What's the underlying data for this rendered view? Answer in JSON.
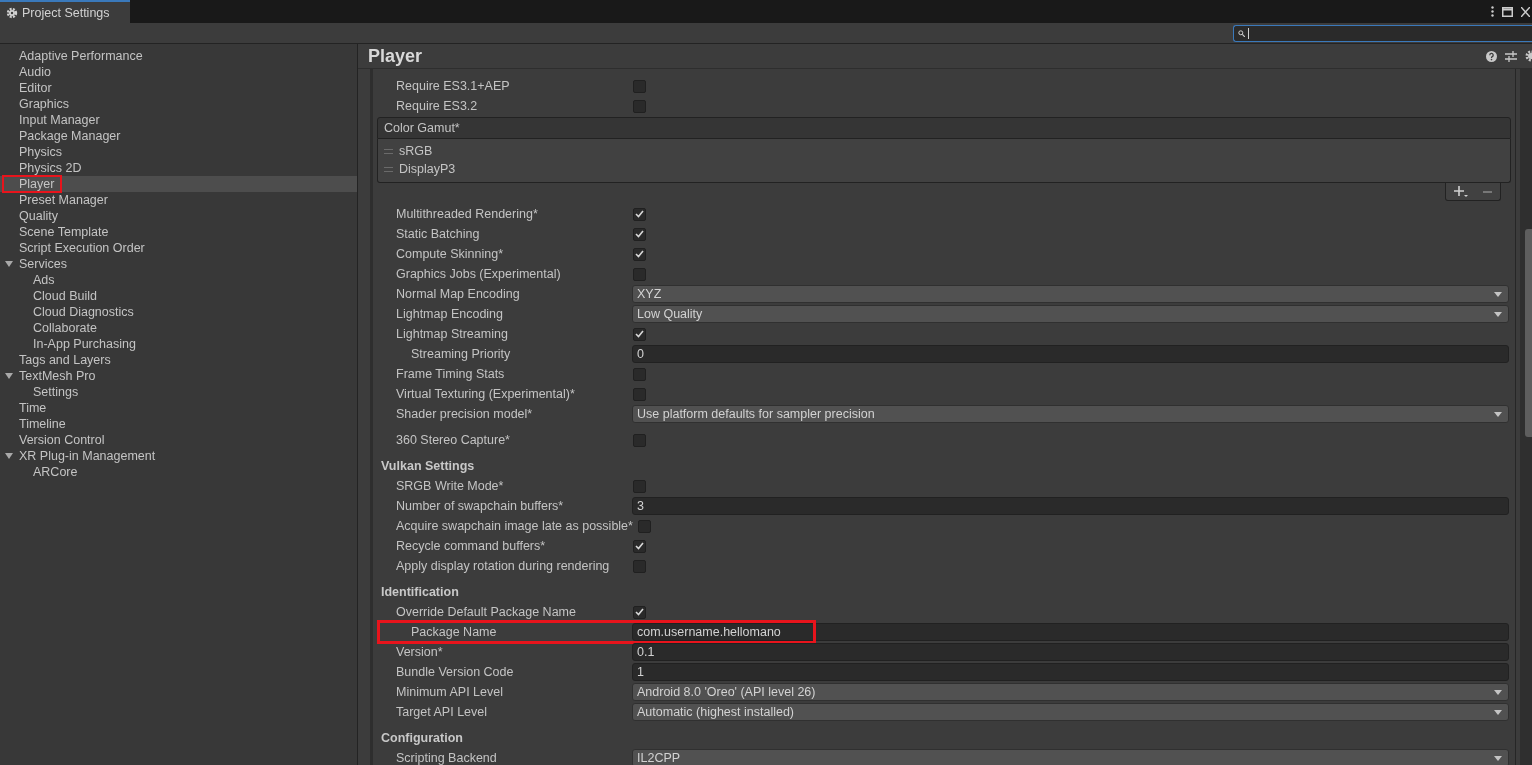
{
  "window": {
    "tab_title": "Project Settings"
  },
  "sidebar": {
    "items": [
      {
        "label": "Adaptive Performance",
        "selected": false
      },
      {
        "label": "Audio",
        "selected": false
      },
      {
        "label": "Editor",
        "selected": false
      },
      {
        "label": "Graphics",
        "selected": false
      },
      {
        "label": "Input Manager",
        "selected": false
      },
      {
        "label": "Package Manager",
        "selected": false
      },
      {
        "label": "Physics",
        "selected": false
      },
      {
        "label": "Physics 2D",
        "selected": false
      },
      {
        "label": "Player",
        "selected": true,
        "highlighted": true
      },
      {
        "label": "Preset Manager",
        "selected": false
      },
      {
        "label": "Quality",
        "selected": false
      },
      {
        "label": "Scene Template",
        "selected": false
      },
      {
        "label": "Script Execution Order",
        "selected": false
      },
      {
        "label": "Services",
        "selected": false,
        "expanded": true,
        "children": [
          {
            "label": "Ads",
            "selected": false
          },
          {
            "label": "Cloud Build",
            "selected": false
          },
          {
            "label": "Cloud Diagnostics",
            "selected": false
          },
          {
            "label": "Collaborate",
            "selected": false
          },
          {
            "label": "In-App Purchasing",
            "selected": false
          }
        ]
      },
      {
        "label": "Tags and Layers",
        "selected": false
      },
      {
        "label": "TextMesh Pro",
        "selected": false,
        "expanded": true,
        "children": [
          {
            "label": "Settings",
            "selected": false
          }
        ]
      },
      {
        "label": "Time",
        "selected": false
      },
      {
        "label": "Timeline",
        "selected": false
      },
      {
        "label": "Version Control",
        "selected": false
      },
      {
        "label": "XR Plug-in Management",
        "selected": false,
        "expanded": true,
        "children": [
          {
            "label": "ARCore",
            "selected": false
          }
        ]
      }
    ]
  },
  "inspector": {
    "title": "Player",
    "sections": [
      {
        "rows": [
          {
            "kind": "checkbox",
            "label": "Require ES3.1+AEP",
            "checked": false
          },
          {
            "kind": "checkbox",
            "label": "Require ES3.2",
            "checked": false
          },
          {
            "kind": "list",
            "label": "Color Gamut*",
            "items": [
              "sRGB",
              "DisplayP3"
            ]
          },
          {
            "kind": "checkbox",
            "label": "Multithreaded Rendering*",
            "checked": true
          },
          {
            "kind": "checkbox",
            "label": "Static Batching",
            "checked": true
          },
          {
            "kind": "checkbox",
            "label": "Compute Skinning*",
            "checked": true
          },
          {
            "kind": "checkbox",
            "label": "Graphics Jobs (Experimental)",
            "checked": false
          },
          {
            "kind": "dropdown",
            "label": "Normal Map Encoding",
            "value": "XYZ"
          },
          {
            "kind": "dropdown",
            "label": "Lightmap Encoding",
            "value": "Low Quality"
          },
          {
            "kind": "checkbox",
            "label": "Lightmap Streaming",
            "checked": true,
            "children": [
              {
                "kind": "text",
                "label": "Streaming Priority",
                "value": "0"
              }
            ]
          },
          {
            "kind": "checkbox",
            "label": "Frame Timing Stats",
            "checked": false
          },
          {
            "kind": "checkbox",
            "label": "Virtual Texturing (Experimental)*",
            "checked": false
          },
          {
            "kind": "dropdown",
            "label": "Shader precision model*",
            "value": "Use platform defaults for sampler precision"
          }
        ]
      },
      {
        "rows": [
          {
            "kind": "checkbox",
            "label": "360 Stereo Capture*",
            "checked": false
          }
        ]
      },
      {
        "title": "Vulkan Settings",
        "rows": [
          {
            "kind": "checkbox",
            "label": "SRGB Write Mode*",
            "checked": false
          },
          {
            "kind": "text",
            "label": "Number of swapchain buffers*",
            "value": "3"
          },
          {
            "kind": "checkbox",
            "label": "Acquire swapchain image late as possible*",
            "checked": false
          },
          {
            "kind": "checkbox",
            "label": "Recycle command buffers*",
            "checked": true
          },
          {
            "kind": "checkbox",
            "label": "Apply display rotation during rendering",
            "checked": false
          }
        ]
      },
      {
        "title": "Identification",
        "rows": [
          {
            "kind": "checkbox",
            "label": "Override Default Package Name",
            "checked": true,
            "children": [
              {
                "kind": "text",
                "label": "Package Name",
                "value": "com.username.hellomano",
                "highlighted": true
              }
            ]
          },
          {
            "kind": "text",
            "label": "Version*",
            "value": "0.1"
          },
          {
            "kind": "text",
            "label": "Bundle Version Code",
            "value": "1"
          },
          {
            "kind": "dropdown",
            "label": "Minimum API Level",
            "value": "Android 8.0 'Oreo' (API level 26)"
          },
          {
            "kind": "dropdown",
            "label": "Target API Level",
            "value": "Automatic (highest installed)"
          }
        ]
      },
      {
        "title": "Configuration",
        "rows": [
          {
            "kind": "dropdown",
            "label": "Scripting Backend",
            "value": "IL2CPP"
          }
        ]
      }
    ]
  }
}
